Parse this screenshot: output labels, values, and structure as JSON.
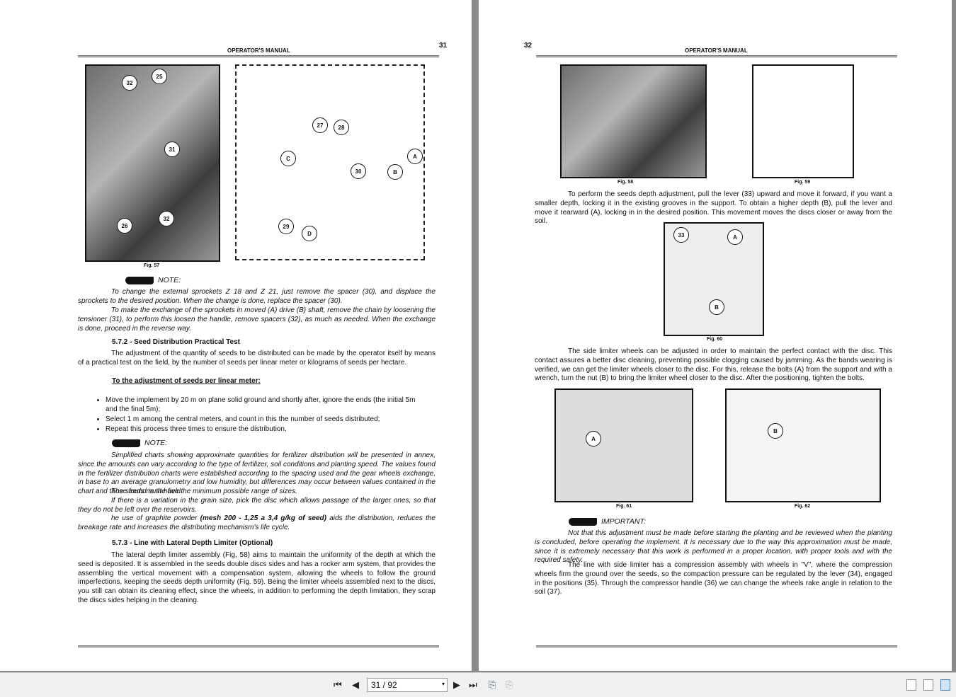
{
  "left_page": {
    "header": "OPERATOR'S MANUAL",
    "page_number": "31",
    "figure_caption": "Fig. 57",
    "callouts_photo": [
      "32",
      "25",
      "31",
      "26",
      "32"
    ],
    "callouts_drawing": [
      "27",
      "28",
      "C",
      "A",
      "30",
      "B",
      "29",
      "D"
    ],
    "note1": {
      "label": "NOTE:",
      "p1": "To change the external sprockets Z 18 and Z 21, just remove the spacer (30), and displace the sprockets to the desired position. When the change is done, replace the spacer (30).",
      "p2": "To make the exchange of the sprockets in moved (A) drive (B) shaft, remove the chain by loosening the tensioner (31), to perform this loosen the handle, remove spacers (32), as much as needed. When the exchange is done, proceed in the reverse way."
    },
    "section_572": {
      "title": "5.7.2 - Seed Distribution Practical Test",
      "text": "The adjustment of the quantity of seeds to be distributed can be made by the operator itself by means of a practical test on the field, by the number of seeds per linear meter or kilograms of seeds per hectare."
    },
    "subheading": "To the adjustment of seeds per linear meter:",
    "bullets": [
      "Move the implement by 20 m on plane solid ground and shortly after, ignore the ends (the initial 5m and the final 5m);",
      "Select 1 m among the central meters, and count in this the number of seeds distributed;",
      "Repeat this process three times to ensure the distribution,"
    ],
    "note2": {
      "label": "NOTE:",
      "p1": "Simplified charts showing approximate quantities for fertilizer distribution will be presented in annex, since the amounts can vary according to the type of fertilizer, soil conditions and planting speed. The values found in the fertilizer distribution charts were established according to the spacing used and the gear wheels exchange, in base to an average granulometry and low humidity, but differences may occur between values contained in the chart and those found in the field.",
      "p2": "The seeds must have the minimum possible range of sizes.",
      "p3": "If there is a variation in the grain size, pick the disc which allows passage of the larger ones, so that they do not be left over the reservoirs.",
      "p4a": "he use of graphite powder ",
      "p4b": "(mesh 200 - 1,25 a 3,4 g/kg of seed)",
      "p4c": " aids the distribution, reduces the breakage rate and increases the distributing mechanism's life cycle."
    },
    "section_573": {
      "title": "5.7.3 - Line with Lateral Depth Limiter (Optional)",
      "text": "The lateral depth limiter assembly (Fig, 58) aims to maintain the uniformity of the depth at which the seed is deposited. It is assembled in the seeds double discs sides and has a rocker arm system, that provides the assembling the vertical movement with a compensation system, allowing the wheels to follow the ground imperfections, keeping the seeds depth uniformity (Fig. 59). Being the limiter wheels assembled next to the discs, you still can obtain its cleaning effect, since the wheels, in addition to performing the depth limitation, they scrap the discs sides helping in the cleaning."
    }
  },
  "right_page": {
    "header": "OPERATOR'S MANUAL",
    "page_number": "32",
    "fig58": "Fig. 58",
    "fig59": "Fig. 59",
    "fig60": "Fig. 60",
    "fig61": "Fig. 61",
    "fig62": "Fig. 62",
    "fig60_callouts": [
      "33",
      "A",
      "B"
    ],
    "fig61_callouts": [
      "A"
    ],
    "fig62_callouts": [
      "B"
    ],
    "p1": "To perform the seeds depth adjustment, pull the lever (33) upward and move it forward, if you want a smaller depth, locking it in the existing grooves in the support. To obtain a higher depth (B), pull the lever and move it rearward (A), locking in in the desired position. This movement moves the discs closer or away from the soil.",
    "p2": "The side limiter wheels can be adjusted in order to maintain the perfect contact with the disc. This contact assures a better disc cleaning, preventing possible clogging caused by jamming. As the bands wearing is verified, we can get the limiter wheels closer to the disc. For this, release the bolts (A) from the support and with a wrench, turn the nut (B) to bring the limiter wheel closer to the disc. After the positioning, tighten the bolts.",
    "important": {
      "label": "IMPORTANT:",
      "text": "Not that this adjustment must be made before starting the planting and be reviewed when the planting is concluded, before operating the implement. It is necessary due to the way this approximation must be made, since it is extremely necessary that this work is performed in a proper location, with proper tools and with the required safety."
    },
    "p3": "The line with side limiter has a compression assembly with wheels in \"V\", where the compression wheels firm the ground over the seeds, so the compaction pressure can be regulated by the lever (34), engaged in the positions (35). Through the compressor handle (36) we can change the wheels rake angle in relation to the soil (37)."
  },
  "toolbar": {
    "page_field": "31 / 92"
  }
}
